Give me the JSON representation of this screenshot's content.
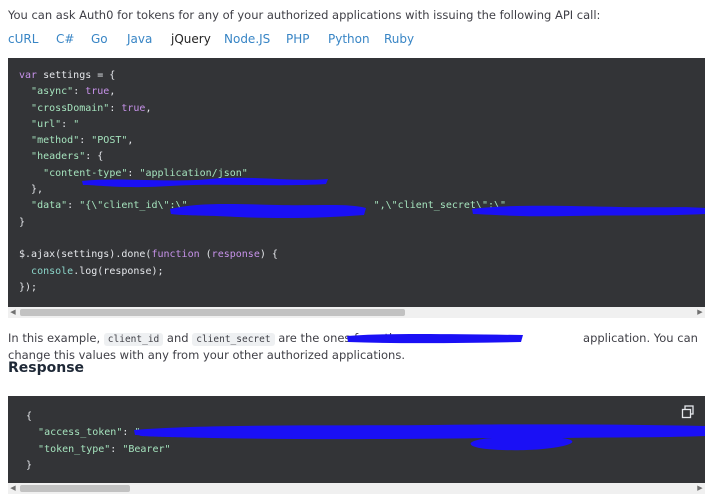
{
  "intro_text": "You can ask Auth0 for tokens for any of your authorized applications with issuing the following API call:",
  "tabs": [
    {
      "label": "cURL"
    },
    {
      "label": "C#"
    },
    {
      "label": "Go"
    },
    {
      "label": "Java"
    },
    {
      "label": "jQuery",
      "active": true
    },
    {
      "label": "Node.JS"
    },
    {
      "label": "PHP"
    },
    {
      "label": "Python"
    },
    {
      "label": "Ruby"
    }
  ],
  "request_code": {
    "l1_kw": "var",
    "l1_rest": " settings = {",
    "async_key": "\"async\"",
    "async_val": "true",
    "crossdomain_key": "\"crossDomain\"",
    "crossdomain_val": "true",
    "url_key": "\"url\"",
    "url_val": "\"",
    "method_key": "\"method\"",
    "method_val": "\"POST\"",
    "headers_key": "\"headers\"",
    "ct_key": "\"content-type\"",
    "ct_val": "\"application/json\"",
    "data_key": "\"data\"",
    "data_val_start": "\"{\\\"client_id\\\":\\\"",
    "data_val_mid": "\",\\\"client_secret\\\":\\\"",
    "ajax_prefix": "$.ajax(settings).done(",
    "function_kw": "function",
    "response_param": "response",
    "ajax_suffix": ") {",
    "console_obj": "console",
    "console_call": ".log(response);",
    "closing": "});"
  },
  "explanation": {
    "before": "In this example, ",
    "code_client_id": "client_id",
    "and": " and ",
    "code_client_secret": "client_secret",
    "middle": " are the ones from the ",
    "after": "application. You can change this values with any from your other authorized applications."
  },
  "response_heading": "Response",
  "response_code": {
    "open": "{",
    "access_token_key": "\"access_token\"",
    "access_token_val": "\"",
    "token_type_key": "\"token_type\"",
    "token_type_val": "\"Bearer\"",
    "close": "}"
  },
  "colors": {
    "link": "#3885c5",
    "code_bg": "#333437",
    "code_string": "#a5e3bd",
    "code_keyword": "#c792ea",
    "redaction": "#1a10f5"
  },
  "icons": {
    "copy": "copy-icon",
    "scroll_left": "arrow-left-icon",
    "scroll_right": "arrow-right-icon"
  }
}
